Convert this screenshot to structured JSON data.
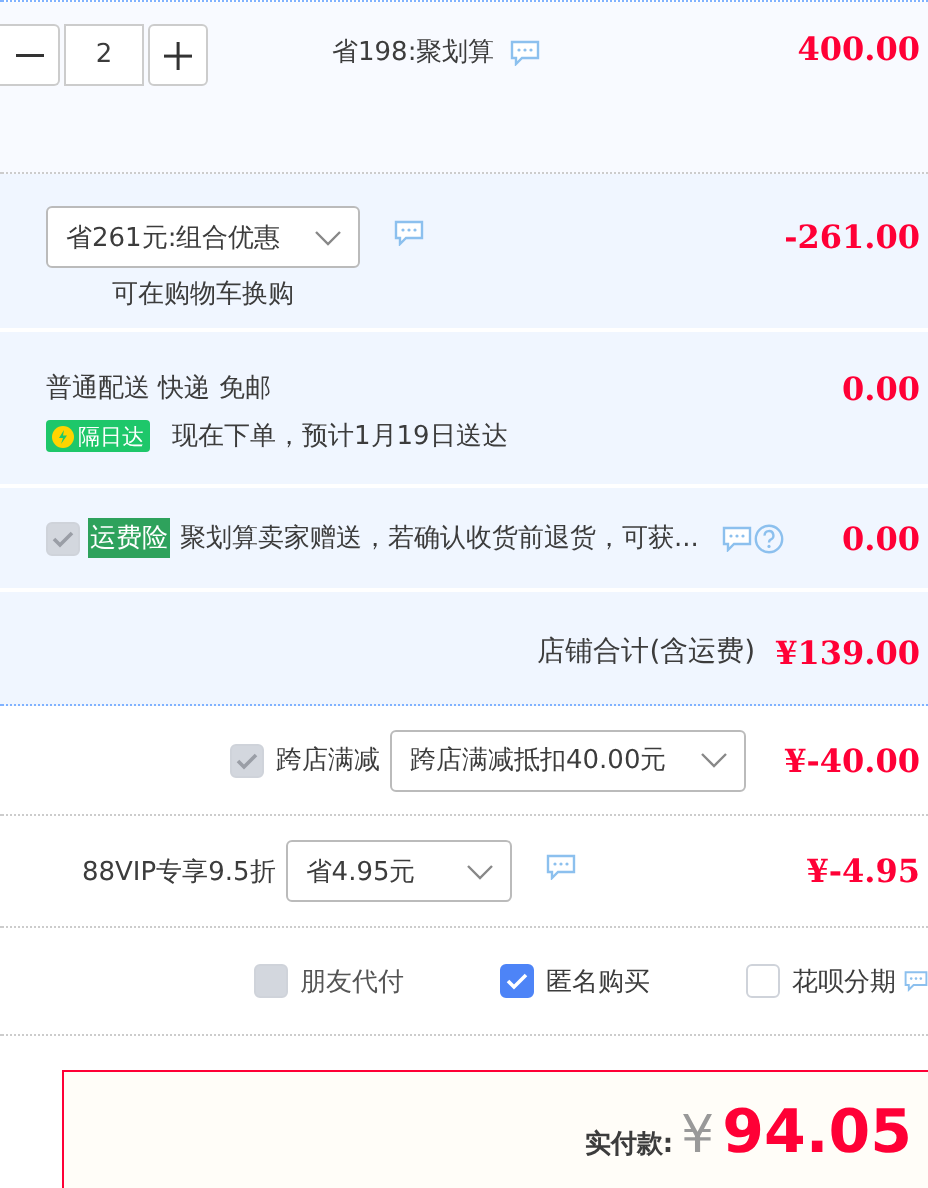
{
  "item": {
    "quantity": "2",
    "promo": "省198:聚划算",
    "price": "400.00"
  },
  "combo": {
    "select": "省261元:组合优惠",
    "note": "可在购物车换购",
    "amount": "-261.00"
  },
  "shipping": {
    "method": "普通配送 快递 免邮",
    "badge": "隔日达",
    "eta": "现在下单，预计1月19日送达",
    "amount": "0.00"
  },
  "insurance": {
    "checked": true,
    "disabled": true,
    "tag": "运费险",
    "text": "聚划算卖家赠送，若确认收货前退货，可获...",
    "amount": "0.00"
  },
  "store_total": {
    "label": "店铺合计(含运费)",
    "amount": "¥139.00"
  },
  "cross_store": {
    "checked": true,
    "disabled": true,
    "label": "跨店满减",
    "select": "跨店满减抵扣40.00元",
    "amount": "¥-40.00"
  },
  "vip": {
    "label": "88VIP专享9.5折",
    "select": "省4.95元",
    "amount": "¥-4.95"
  },
  "options": [
    {
      "label": "朋友代付",
      "checked": false,
      "disabled": true
    },
    {
      "label": "匿名购买",
      "checked": true,
      "disabled": false
    },
    {
      "label": "花呗分期",
      "checked": false,
      "disabled": false
    }
  ],
  "payment": {
    "label": "实付款:",
    "currency": "¥",
    "amount": "94.05"
  }
}
